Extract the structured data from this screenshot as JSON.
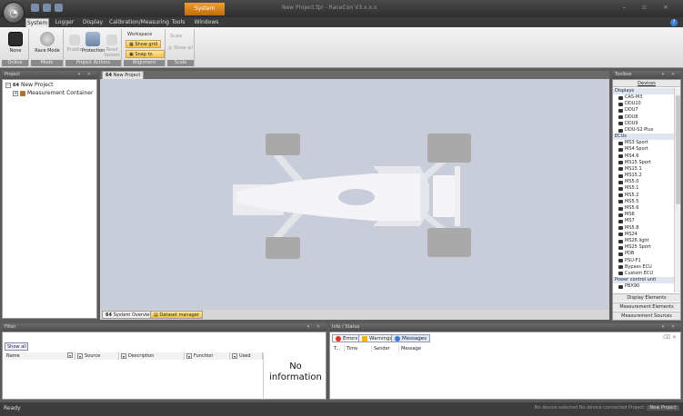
{
  "titlebar": {
    "context_tab": "System",
    "app_title": "New Project.fpr - RaceCon V3.x.x.x",
    "window_controls": "– ▫ ×"
  },
  "tabs": [
    {
      "label": "System",
      "active": true
    },
    {
      "label": "Logger",
      "active": false
    },
    {
      "label": "Display",
      "active": false
    },
    {
      "label": "Calibration/Measuring",
      "active": false
    },
    {
      "label": "Tools",
      "active": false
    },
    {
      "label": "Windows",
      "active": false
    }
  ],
  "ribbon": {
    "none_label": "None",
    "race_mode_label": "Race Mode",
    "mode_group": "Mode",
    "online_group": "Online",
    "enable_label": "Enable",
    "protection_label": "Protection",
    "read_label": "Read fastest",
    "project_group": "Project Actions",
    "workspace_label": "Workspace",
    "show_grid": "Show grid",
    "snap_grid": "Snap to grid",
    "show_all": "Show all",
    "align_group": "Alignment",
    "scale_label": "Scale",
    "scale_group": "Scale"
  },
  "project": {
    "header": "Project",
    "root": "New Project",
    "child": "Measurement Container"
  },
  "document": {
    "tab": "New Project",
    "bottom_tabs": [
      "System Overview",
      "Dataset manager"
    ]
  },
  "toolbox": {
    "header": "Toolbox",
    "section": "Devices",
    "categories": [
      {
        "name": "Displays",
        "items": [
          "CAS-M3",
          "DDU10",
          "DDU7",
          "DDU8",
          "DDU9",
          "DDU-S2 Plus"
        ]
      },
      {
        "name": "ECUs",
        "items": [
          "MS3 Sport",
          "MS4 Sport",
          "MS4.6",
          "MS15 Sport",
          "MS15.1",
          "MS15.2",
          "MS5.0",
          "MS5.1",
          "MS5.2",
          "MS5.5",
          "MS5.6",
          "MS6",
          "MS7",
          "MS5.8",
          "MS24",
          "MS26 light",
          "MS25 Sport",
          "PDB",
          "PSU-F1",
          "Bypass ECU",
          "Custom ECU"
        ]
      },
      {
        "name": "Power control unit",
        "items": [
          "PBX90"
        ]
      }
    ],
    "footers": [
      "Display Elements",
      "Measurement Elements",
      "Measurement Sources"
    ]
  },
  "filter": {
    "header": "Filter",
    "show_all": "Show all",
    "columns": [
      "Name",
      "Source",
      "Description",
      "Function",
      "Used"
    ],
    "empty_line1": "No",
    "empty_line2": "information"
  },
  "info": {
    "header": "Info / Status",
    "buttons": [
      "Errors",
      "Warnings",
      "Messages"
    ],
    "columns": [
      "T...",
      "Time",
      "Sender",
      "Message"
    ]
  },
  "status": {
    "ready": "Ready",
    "right": "No device selected   No device connected   Project: ",
    "project": "New Project"
  },
  "colors": {
    "accent_orange": "#f6c040",
    "canvas": "#c9cdd9"
  }
}
